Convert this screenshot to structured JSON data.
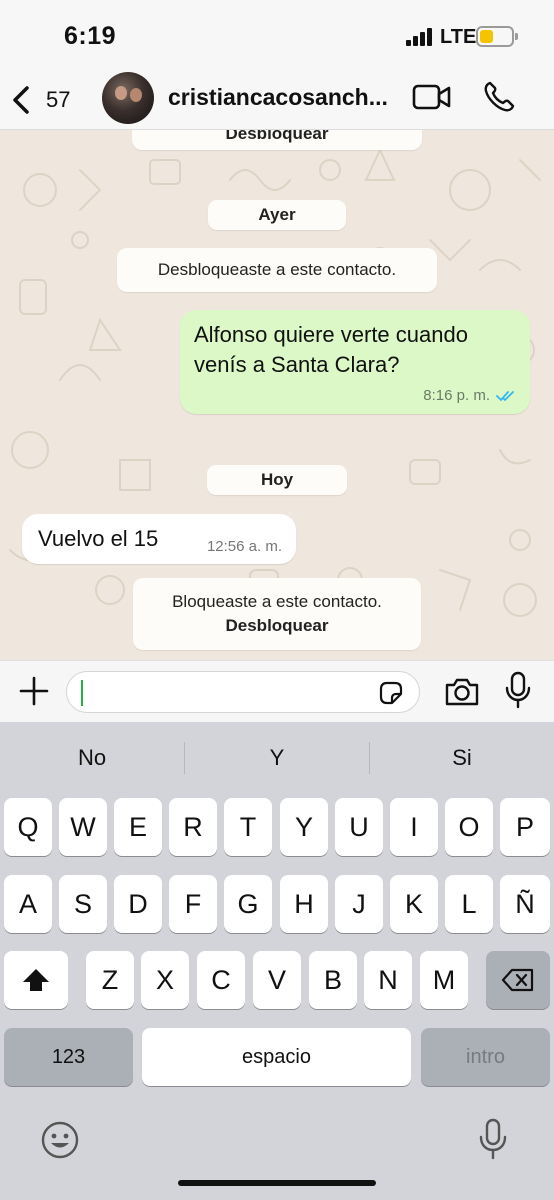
{
  "status_bar": {
    "time": "6:19",
    "network": "LTE",
    "battery_color": "#f5c400"
  },
  "header": {
    "back_count": "57",
    "contact_name": "cristiancacosanch..."
  },
  "chat": {
    "top_partial_action": "Desbloquear",
    "date_yesterday": "Ayer",
    "sys_unblocked": "Desbloqueaste a este contacto.",
    "outgoing": {
      "text": "Alfonso quiere verte cuando venís a Santa Clara?",
      "time": "8:16 p. m.",
      "status_color": "#34b7f1"
    },
    "date_today": "Hoy",
    "incoming": {
      "text": "Vuelvo el 15",
      "time": "12:56 a. m."
    },
    "sys_blocked": "Bloqueaste a este contacto.",
    "sys_blocked_action": "Desbloquear"
  },
  "input": {
    "placeholder": ""
  },
  "keyboard": {
    "suggestions": [
      "No",
      "Y",
      "Si"
    ],
    "row1": [
      "Q",
      "W",
      "E",
      "R",
      "T",
      "Y",
      "U",
      "I",
      "O",
      "P"
    ],
    "row2": [
      "A",
      "S",
      "D",
      "F",
      "G",
      "H",
      "J",
      "K",
      "L",
      "Ñ"
    ],
    "row3": [
      "Z",
      "X",
      "C",
      "V",
      "B",
      "N",
      "M"
    ],
    "numbers_label": "123",
    "space_label": "espacio",
    "return_label": "intro"
  },
  "colors": {
    "accent": "#25b04a",
    "outgoing_bubble": "#dcf8c6",
    "chat_background": "#efe7dd"
  }
}
